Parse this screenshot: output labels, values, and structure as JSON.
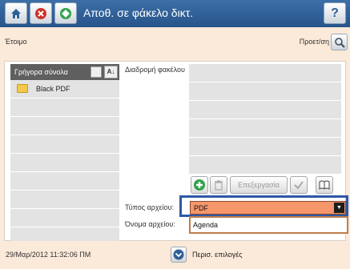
{
  "header": {
    "title": "Αποθ. σε φάκελο δικτ.",
    "help_symbol": "?",
    "icons": [
      "home-icon",
      "stop-icon",
      "start-icon",
      "help-icon"
    ]
  },
  "status": {
    "text": "Έτοιμο",
    "advanced": "Προετ/ση"
  },
  "quick_sets": {
    "title": "Γρήγορα σύνολα",
    "sort_label": "A↓",
    "items": [
      "Black PDF",
      "",
      "",
      "",
      "",
      "",
      "",
      "",
      ""
    ]
  },
  "folder_path": {
    "label": "Διαδρομή φακέλου",
    "rows": [
      "",
      "",
      "",
      "",
      "",
      ""
    ]
  },
  "toolbar": {
    "edit_label": "Επεξεργασία"
  },
  "file_type": {
    "label": "Τύπος αρχείου:",
    "value": "PDF"
  },
  "file_name": {
    "label": "Όνομα αρχείου:",
    "value": "Agenda"
  },
  "footer": {
    "timestamp": "29/Μαρ/2012 11:32:06 ΠΜ",
    "more_options": "Περισ. επιλογές"
  },
  "colors": {
    "header_bg": "#2f5f98",
    "accent_select": "#f5966b",
    "highlight_frame": "#2d58a7",
    "name_border": "#c17d4a",
    "background": "#fbe9d9"
  }
}
